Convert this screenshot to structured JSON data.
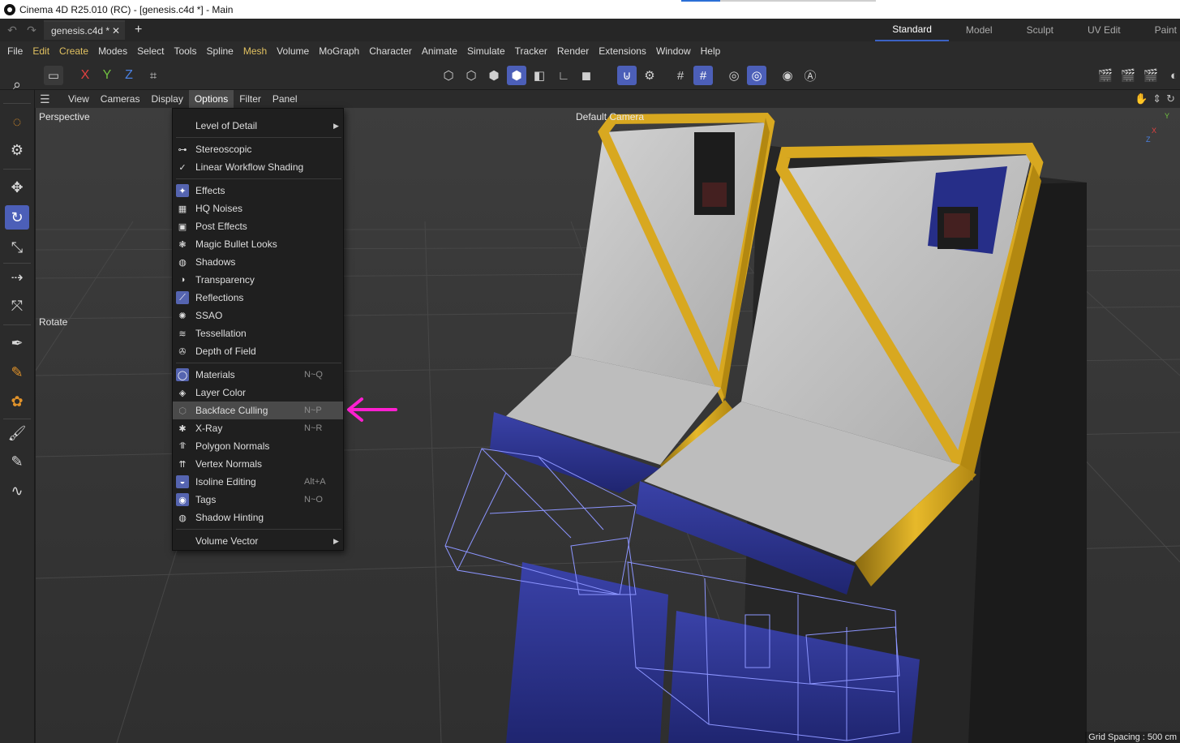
{
  "window": {
    "title": "Cinema 4D R25.010 (RC) - [genesis.c4d *] - Main"
  },
  "tabs": {
    "document": "genesis.c4d *",
    "close": "✕",
    "new": "+"
  },
  "layouts": [
    "Standard",
    "Model",
    "Sculpt",
    "UV Edit",
    "Paint"
  ],
  "menu": [
    "File",
    "Edit",
    "Create",
    "Modes",
    "Select",
    "Tools",
    "Spline",
    "Mesh",
    "Volume",
    "MoGraph",
    "Character",
    "Animate",
    "Simulate",
    "Tracker",
    "Render",
    "Extensions",
    "Window",
    "Help"
  ],
  "toolbar": {
    "axis_x": "X",
    "axis_y": "Y",
    "axis_z": "Z"
  },
  "viewport_menu": [
    "View",
    "Cameras",
    "Display",
    "Options",
    "Filter",
    "Panel"
  ],
  "viewport": {
    "projection": "Perspective",
    "camera": "Default Camera",
    "tool_label": "Rotate",
    "grid_spacing": "Grid Spacing : 500 cm",
    "axis_y": "Y",
    "axis_x": "X",
    "axis_z": "Z"
  },
  "options_menu": {
    "level_of_detail": "Level of Detail",
    "stereoscopic": "Stereoscopic",
    "linear_workflow": "Linear Workflow Shading",
    "effects": "Effects",
    "hq_noises": "HQ Noises",
    "post_effects": "Post Effects",
    "magic_bullet": "Magic Bullet Looks",
    "shadows": "Shadows",
    "transparency": "Transparency",
    "reflections": "Reflections",
    "ssao": "SSAO",
    "tessellation": "Tessellation",
    "depth_of_field": "Depth of Field",
    "materials": "Materials",
    "materials_sc": "N~Q",
    "layer_color": "Layer Color",
    "backface_culling": "Backface Culling",
    "backface_sc": "N~P",
    "xray": "X-Ray",
    "xray_sc": "N~R",
    "polygon_normals": "Polygon Normals",
    "vertex_normals": "Vertex Normals",
    "isoline_editing": "Isoline Editing",
    "isoline_sc": "Alt+A",
    "tags": "Tags",
    "tags_sc": "N~O",
    "shadow_hinting": "Shadow Hinting",
    "volume_vector": "Volume Vector"
  },
  "colors": {
    "accent_blue": "#4c5fb8",
    "annotation_magenta": "#ff1fd0",
    "cabinet_yellow": "#d8a820",
    "cabinet_blue": "#2e3590"
  }
}
